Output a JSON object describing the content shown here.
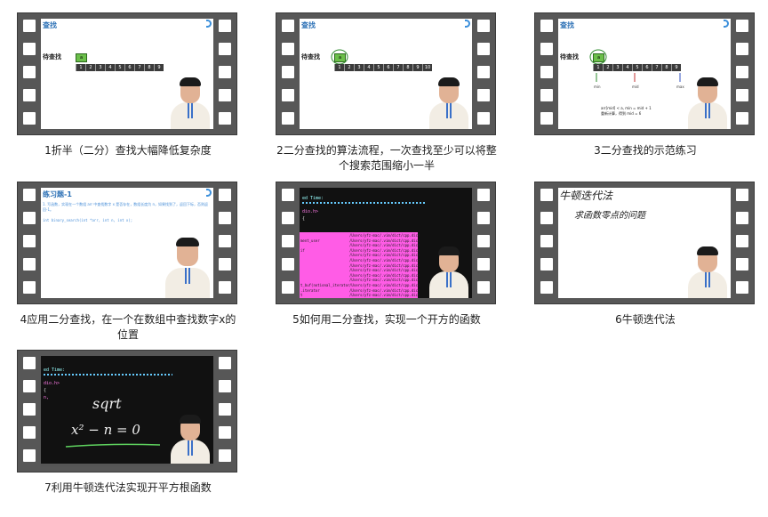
{
  "videos": [
    {
      "caption": "1折半（二分）查找大幅降低复杂度",
      "slide_title": "查找",
      "label": "待查找",
      "box_value": "a",
      "array": [
        "1",
        "2",
        "3",
        "4",
        "5",
        "6",
        "7",
        "8",
        "9"
      ]
    },
    {
      "caption": "2二分查找的算法流程，一次查找至少可以将整个搜索范围缩小一半",
      "slide_title": "查找",
      "label": "待查找",
      "box_value": "a",
      "array": [
        "1",
        "2",
        "3",
        "4",
        "5",
        "6",
        "7",
        "8",
        "9",
        "10"
      ]
    },
    {
      "caption": "3二分查找的示范练习",
      "slide_title": "查找",
      "label": "待查找",
      "box_value": "a",
      "array": [
        "1",
        "2",
        "3",
        "4",
        "5",
        "6",
        "7",
        "8",
        "9"
      ],
      "markers": [
        "min",
        "mid",
        "max"
      ],
      "notes": [
        "arr[mid] < a, min = mid + 1",
        "重新计算，得到 mid = 6"
      ]
    },
    {
      "caption": "4应用二分查找，在一个在数组中查找数字x的位置",
      "slide_title": "练习题-1",
      "desc": "1. 写函数，实现在一个数组 arr 中查找数字 x 是否存在，数组长度为 n，如果找到了，返回下标，否则返回-1。",
      "code": "int binary_search(int *arr, int n, int x);"
    },
    {
      "caption": "5如何用二分查找，实现一个开方的函数",
      "code_lines": [
        "ed Time:",
        "dio.h>",
        "{"
      ],
      "rows_left": [
        "",
        "ment_user",
        "",
        "if",
        "",
        "",
        "",
        "",
        "",
        "",
        "t_buf(notional_iterator",
        ".iterator",
        "t"
      ],
      "rows_right": [
        "/Users/yfz-mac/.vim/dict/cpp.dict",
        "/Users/yfz-mac/.vim/dict/cpp.dict",
        "/Users/yfz-mac/.vim/dict/cpp.dict",
        "/Users/yfz-mac/.vim/dict/cpp.dict",
        "/Users/yfz-mac/.vim/dict/cpp.dict",
        "/Users/yfz-mac/.vim/dict/cpp.dict",
        "/Users/yfz-mac/.vim/dict/cpp.dict",
        "/Users/yfz-mac/.vim/dict/cpp.dict",
        "/Users/yfz-mac/.vim/dict/cpp.dict",
        "/Users/yfz-mac/.vim/dict/cpp.dict",
        "/Users/yfz-mac/.vim/dict/cpp.dict",
        "/Users/yfz-mac/.vim/dict/cpp.dict",
        "/Users/yfz-mac/.vim/dict/cpp.dict"
      ]
    },
    {
      "caption": "6牛顿迭代法",
      "hand_lines": [
        "牛顿迭代法",
        "求函数零点的问题"
      ]
    },
    {
      "caption": "7利用牛顿迭代法实现开平方根函数",
      "code_lines": [
        "ed Time:",
        "dio.h>",
        "{",
        "n,"
      ],
      "hand_lines": [
        "sqrt",
        "x² − n = 0"
      ]
    }
  ]
}
